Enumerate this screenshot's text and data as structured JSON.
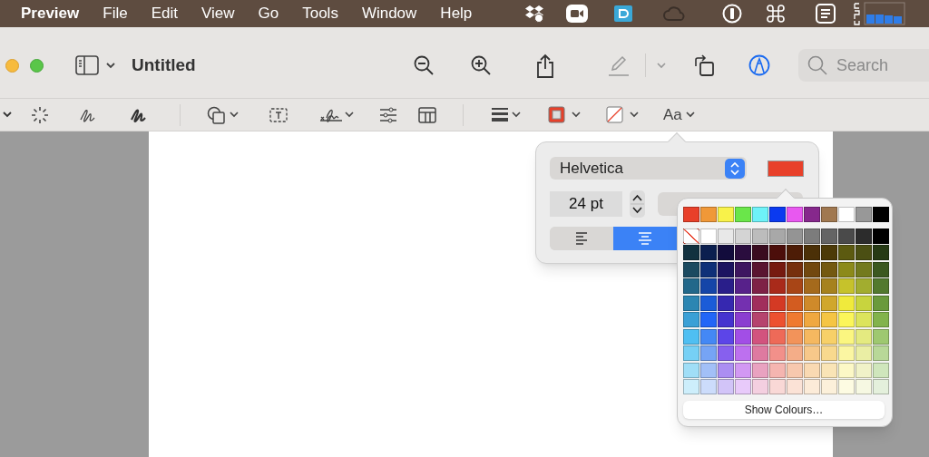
{
  "menu_bar": {
    "app": "Preview",
    "items": [
      "File",
      "Edit",
      "View",
      "Go",
      "Tools",
      "Window",
      "Help"
    ]
  },
  "window": {
    "title": "Untitled",
    "markup_mode": {
      "on": true
    },
    "search": {
      "placeholder": "Search"
    }
  },
  "markup_toolbar": {
    "text_style_label": "Aa"
  },
  "text_popover": {
    "font": "Helvetica",
    "color_well": {
      "color": "#e8402a"
    },
    "size": "24 pt",
    "alignment": [
      {
        "kind": "left",
        "selected": false
      },
      {
        "kind": "center",
        "selected": true
      }
    ]
  },
  "color_palette": {
    "rows": [
      {
        "swatches": [
          {
            "color": "#e8402a"
          },
          {
            "color": "#f09838"
          },
          {
            "color": "#f8f24a"
          },
          {
            "color": "#6ae64a"
          },
          {
            "color": "#6ef2f8"
          },
          {
            "color": "#0a3af0"
          },
          {
            "color": "#e858f0"
          },
          {
            "color": "#86288c"
          },
          {
            "color": "#a07850"
          },
          {
            "color": "#ffffff"
          },
          {
            "color": "#989898"
          },
          {
            "color": "#000000"
          }
        ]
      },
      {
        "swatches": [
          {
            "kind": "none"
          },
          {
            "color": "#ffffff"
          },
          {
            "color": "#e8e8e8"
          },
          {
            "color": "#d4d4d4"
          },
          {
            "color": "#bcbcbc"
          },
          {
            "color": "#a8a8a8"
          },
          {
            "color": "#949494"
          },
          {
            "color": "#7c7c7c"
          },
          {
            "color": "#646464"
          },
          {
            "color": "#4a4a4a"
          },
          {
            "color": "#2c2c2c"
          },
          {
            "color": "#000000"
          }
        ]
      },
      {
        "swatches": [
          {
            "color": "#12313f"
          },
          {
            "color": "#0b1f4f"
          },
          {
            "color": "#120c3c"
          },
          {
            "color": "#2a0d3e"
          },
          {
            "color": "#3a0c1f"
          },
          {
            "color": "#4c0e0a"
          },
          {
            "color": "#4d1c06"
          },
          {
            "color": "#4b3007"
          },
          {
            "color": "#4c3a07"
          },
          {
            "color": "#5c5a10"
          },
          {
            "color": "#4b4f13"
          },
          {
            "color": "#263a14"
          }
        ]
      },
      {
        "swatches": [
          {
            "color": "#1b4a60"
          },
          {
            "color": "#0f3078"
          },
          {
            "color": "#1c1460"
          },
          {
            "color": "#3e1660"
          },
          {
            "color": "#5a1530"
          },
          {
            "color": "#761a10"
          },
          {
            "color": "#762f0d"
          },
          {
            "color": "#72480f"
          },
          {
            "color": "#745910"
          },
          {
            "color": "#8c8a1a"
          },
          {
            "color": "#737a1e"
          },
          {
            "color": "#3b5820"
          }
        ]
      },
      {
        "swatches": [
          {
            "color": "#22688a"
          },
          {
            "color": "#1545a8"
          },
          {
            "color": "#291e8a"
          },
          {
            "color": "#57218a"
          },
          {
            "color": "#7e2146"
          },
          {
            "color": "#a92a1a"
          },
          {
            "color": "#a84516"
          },
          {
            "color": "#a56a1c"
          },
          {
            "color": "#a6821e"
          },
          {
            "color": "#c6c22b"
          },
          {
            "color": "#a2ad2f"
          },
          {
            "color": "#52792e"
          }
        ]
      },
      {
        "swatches": [
          {
            "color": "#2c86b2"
          },
          {
            "color": "#1b5cd8"
          },
          {
            "color": "#3628b0"
          },
          {
            "color": "#7430b0"
          },
          {
            "color": "#a12e5c"
          },
          {
            "color": "#d43a24"
          },
          {
            "color": "#d35c20"
          },
          {
            "color": "#cf8a2a"
          },
          {
            "color": "#d0a72c"
          },
          {
            "color": "#f0ea3c"
          },
          {
            "color": "#c8d43e"
          },
          {
            "color": "#6a9a3c"
          }
        ]
      },
      {
        "swatches": [
          {
            "color": "#3aa0d6"
          },
          {
            "color": "#2266f7"
          },
          {
            "color": "#4534cf"
          },
          {
            "color": "#8b3ed0"
          },
          {
            "color": "#b6446e"
          },
          {
            "color": "#ed5130"
          },
          {
            "color": "#ef7a30"
          },
          {
            "color": "#f0a840"
          },
          {
            "color": "#f5c544"
          },
          {
            "color": "#fbf65a"
          },
          {
            "color": "#dce45c"
          },
          {
            "color": "#82b34c"
          }
        ]
      },
      {
        "swatches": [
          {
            "color": "#4fbff2"
          },
          {
            "color": "#4488f5"
          },
          {
            "color": "#5c45e8"
          },
          {
            "color": "#a24ee6"
          },
          {
            "color": "#d2537e"
          },
          {
            "color": "#ee6a58"
          },
          {
            "color": "#f2935a"
          },
          {
            "color": "#f5b860"
          },
          {
            "color": "#f7d068"
          },
          {
            "color": "#fbf680"
          },
          {
            "color": "#e4ea80"
          },
          {
            "color": "#9ec870"
          }
        ]
      },
      {
        "swatches": [
          {
            "color": "#76d0f5"
          },
          {
            "color": "#76a4f5"
          },
          {
            "color": "#8760ee"
          },
          {
            "color": "#bd70ef"
          },
          {
            "color": "#de7aa0"
          },
          {
            "color": "#f2908a"
          },
          {
            "color": "#f4ad88"
          },
          {
            "color": "#f7c88a"
          },
          {
            "color": "#f8d98e"
          },
          {
            "color": "#fbf6a2"
          },
          {
            "color": "#eaeea4"
          },
          {
            "color": "#b8d898"
          }
        ]
      },
      {
        "swatches": [
          {
            "color": "#a0def7"
          },
          {
            "color": "#a2c0f7"
          },
          {
            "color": "#ab8ef2"
          },
          {
            "color": "#d298f3"
          },
          {
            "color": "#e9a2c0"
          },
          {
            "color": "#f5b5b0"
          },
          {
            "color": "#f7c8ae"
          },
          {
            "color": "#f9d9b2"
          },
          {
            "color": "#f9e4b6"
          },
          {
            "color": "#fcf8c6"
          },
          {
            "color": "#f0f2c8"
          },
          {
            "color": "#cfe6bc"
          }
        ]
      },
      {
        "swatches": [
          {
            "color": "#cdeefb"
          },
          {
            "color": "#ccdcfb"
          },
          {
            "color": "#d2c4f8"
          },
          {
            "color": "#e8cafa"
          },
          {
            "color": "#f4cfe0"
          },
          {
            "color": "#f9d8d6"
          },
          {
            "color": "#fbe2d6"
          },
          {
            "color": "#fcebd8"
          },
          {
            "color": "#fcf0da"
          },
          {
            "color": "#fdfbe2"
          },
          {
            "color": "#f6f8e2"
          },
          {
            "color": "#e4f0dc"
          }
        ]
      }
    ],
    "button": "Show Colours…"
  }
}
